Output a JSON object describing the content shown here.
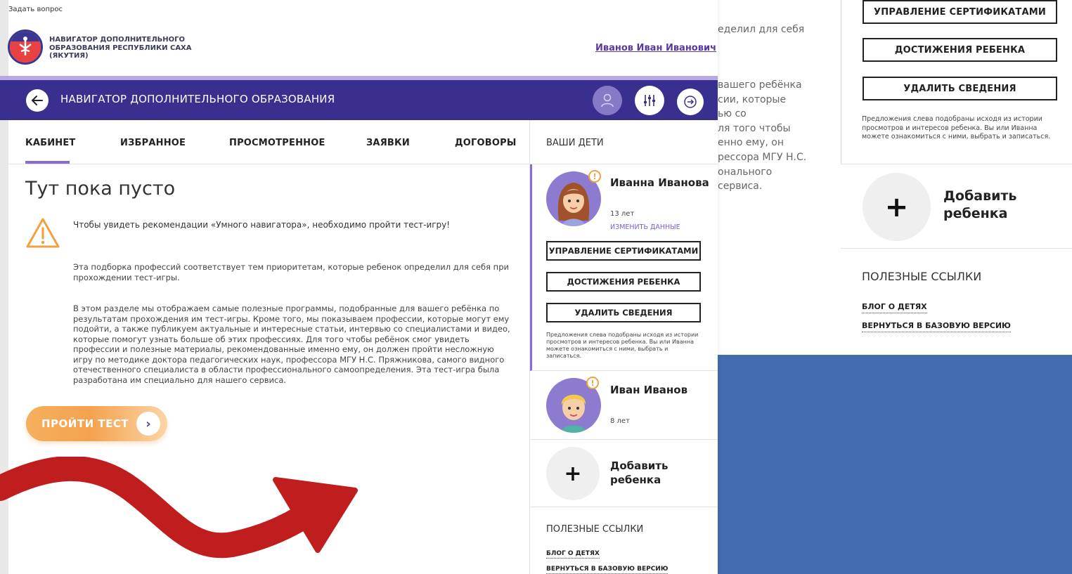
{
  "background": {
    "text_top": "еделил для себя",
    "text_lines": [
      "вашего ребёнка",
      "сии, которые",
      "ью со",
      "ля того чтобы",
      "енно ему, он",
      "рессора МГУ Н.С.",
      "онального",
      "сервиса."
    ],
    "sidebar": {
      "buttons": [
        "УПРАВЛЕНИЕ СЕРТИФИКАТАМИ",
        "ДОСТИЖЕНИЯ РЕБЕНКА",
        "УДАЛИТЬ СВЕДЕНИЯ"
      ],
      "note": "Предложения слева подобраны исходя из истории просмотров и интересов ребенка. Вы или Иванна можете ознакомиться с ними, выбрать и записаться.",
      "add_child_plus": "+",
      "add_child_label": "Добавить ребенка",
      "links_title": "ПОЛЕЗНЫЕ ССЫЛКИ",
      "links": [
        "БЛОГ О ДЕТЯХ",
        "ВЕРНУТЬСЯ В БАЗОВУЮ ВЕРСИЮ"
      ]
    },
    "accent_blue": "#436cb1"
  },
  "window": {
    "ask_question": "Задать вопрос",
    "org_name": "НАВИГАТОР ДОПОЛНИТЕЛЬНОГО ОБРАЗОВАНИЯ РЕСПУБЛИКИ САХА (ЯКУТИЯ)",
    "user_name": "Иванов Иван Иванович",
    "navbar": {
      "title": "НАВИГАТОР ДОПОЛНИТЕЛЬНОГО ОБРАЗОВАНИЯ",
      "color": "#392f8f",
      "back_icon": "arrow-left-icon",
      "profile_icon": "user-icon",
      "filter_icon": "sliders-icon",
      "exit_icon": "logout-icon"
    },
    "tabs": [
      {
        "label": "КАБИНЕТ",
        "active": true
      },
      {
        "label": "ИЗБРАННОЕ"
      },
      {
        "label": "ПРОСМОТРЕННОЕ"
      },
      {
        "label": "ЗАЯВКИ"
      },
      {
        "label": "ДОГОВОРЫ"
      }
    ],
    "main": {
      "title": "Тут пока пусто",
      "warning_icon": "warning-triangle-icon",
      "warning_text": "Чтобы увидеть рекомендации «Умного навигатора», необходимо пройти тест-игру!",
      "para1": "Эта подборка профессий соответствует тем приоритетам, которые ребенок определил для себя при прохождении тест-игры.",
      "para2": "В этом разделе мы отображаем самые полезные программы, подобранные для вашего ребёнка по результатам прохождения им тест-игры. Кроме того, мы показываем профессии, которые могут ему подойти, а также публикуем актуальные и интересные статьи, интервью со специалистами и видео, которые помогут узнать больше об этих профессиях. Для того чтобы ребёнок смог увидеть профессии и полезные материалы, рекомендованные именно ему, он должен пройти несложную игру по методике доктора педагогических наук, профессора МГУ Н.С. Пряжникова, самого видного отечественного специалиста в области профессионального самоопределения. Эта тест-игра была разработана им специально для нашего сервиса.",
      "test_button": "ПРОЙТИ ТЕСТ",
      "test_arrow": "›"
    },
    "sidebar": {
      "title": "ВАШИ ДЕТИ",
      "badge": "!",
      "children": [
        {
          "name": "Иванна Иванова",
          "age": "13 лет",
          "edit": "ИЗМЕНИТЬ ДАННЫЕ",
          "buttons": [
            "УПРАВЛЕНИЕ СЕРТИФИКАТАМИ",
            "ДОСТИЖЕНИЯ РЕБЕНКА",
            "УДАЛИТЬ СВЕДЕНИЯ"
          ],
          "note": "Предложения слева подобраны исходя из истории просмотров и интересов ребенка. Вы или Иванна можете ознакомиться с ними, выбрать и записаться."
        },
        {
          "name": "Иван Иванов",
          "age": "8 лет"
        }
      ],
      "add_child_plus": "+",
      "add_child_label": "Добавить ребенка",
      "links_title": "ПОЛЕЗНЫЕ ССЫЛКИ",
      "links": [
        "БЛОГ О ДЕТЯХ",
        "ВЕРНУТЬСЯ В БАЗОВУЮ ВЕРСИЮ"
      ]
    },
    "accent_purple": "#8b6bd0",
    "accent_orange": "#f4a24f",
    "decor_arrow_color": "#c01e1e"
  }
}
